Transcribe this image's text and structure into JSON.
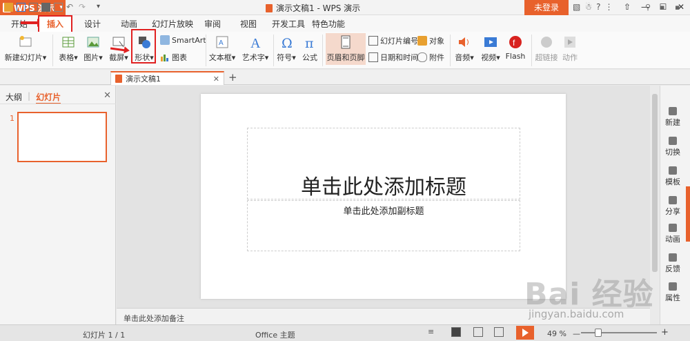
{
  "titlebar": {
    "app_name": "WPS 演示",
    "app_icon": "P",
    "doc_title": "演示文稿1 - WPS 演示",
    "login": "未登录",
    "win_min": "—",
    "win_max": "☐",
    "win_close": "✕"
  },
  "menu": {
    "tabs": [
      "开始",
      "插入",
      "设计",
      "动画",
      "幻灯片放映",
      "审阅",
      "视图",
      "开发工具",
      "特色功能"
    ]
  },
  "ribbon": {
    "new_slide": "新建幻灯片",
    "table": "表格",
    "picture": "图片",
    "screenshot": "截屏",
    "shape": "形状",
    "smartart": "SmartArt",
    "chart": "图表",
    "textbox": "文本框",
    "wordart": "艺术字",
    "symbol": "符号",
    "formula": "公式",
    "header_footer": "页眉和页脚",
    "slide_number": "幻灯片编号",
    "object": "对象",
    "date_time": "日期和时间",
    "attachment": "附件",
    "audio": "音频",
    "video": "视频",
    "flash": "Flash",
    "hyperlink": "超链接",
    "action": "动作",
    "dropdown_glyph": "▾"
  },
  "doc_tabs": {
    "active_label": "演示文稿1",
    "close_glyph": "✕",
    "add_glyph": "+"
  },
  "left_panel": {
    "tab_outline": "大纲",
    "tab_slides": "幻灯片",
    "close_glyph": "✕",
    "slide_number": "1"
  },
  "slide": {
    "title_placeholder": "单击此处添加标题",
    "subtitle_placeholder": "单击此处添加副标题"
  },
  "notes": {
    "placeholder": "单击此处添加备注"
  },
  "right_panel": {
    "items": [
      "新建",
      "切换",
      "模板",
      "分享",
      "动画",
      "反馈",
      "属性"
    ]
  },
  "status": {
    "slide_info": "幻灯片 1 / 1",
    "theme": "Office 主题",
    "zoom": "49 %",
    "zoom_minus": "—",
    "zoom_plus": "+"
  },
  "watermark": {
    "logo_text": "Bai 经验",
    "url": "jingyan.baidu.com"
  },
  "colors": {
    "accent": "#e8612c",
    "highlight_box": "#e02020"
  }
}
